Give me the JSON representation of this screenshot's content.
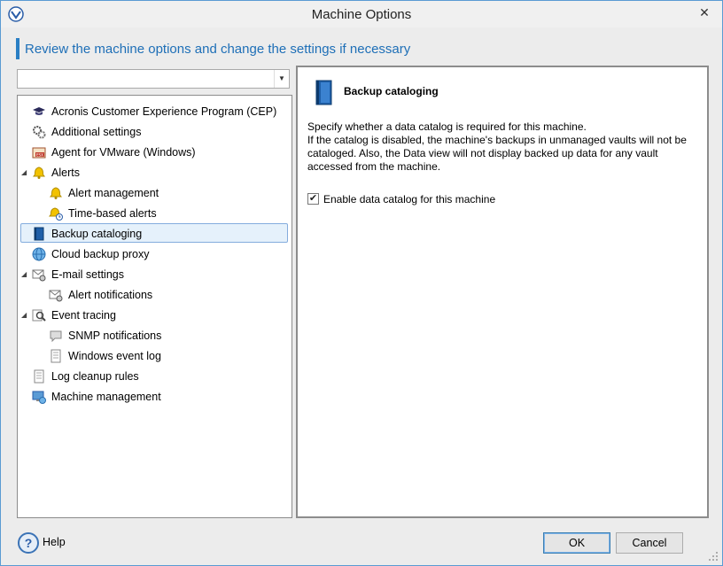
{
  "window": {
    "title": "Machine Options",
    "close_glyph": "✕"
  },
  "header": {
    "text": "Review the machine options and change the settings if necessary"
  },
  "dropdown": {
    "value": "",
    "arrow_glyph": "▼"
  },
  "tree": {
    "items": [
      {
        "label": "Acronis Customer Experience Program (CEP)",
        "icon": "graduation-cap-icon"
      },
      {
        "label": "Additional settings",
        "icon": "gears-icon"
      },
      {
        "label": "Agent for VMware (Windows)",
        "icon": "esx-agent-icon"
      },
      {
        "label": "Alerts",
        "icon": "bell-icon",
        "expanded": true
      },
      {
        "label": "Alert management",
        "icon": "bell-icon"
      },
      {
        "label": "Time-based alerts",
        "icon": "bell-clock-icon"
      },
      {
        "label": "Backup cataloging",
        "icon": "blue-book-icon",
        "selected": true
      },
      {
        "label": "Cloud backup proxy",
        "icon": "globe-icon"
      },
      {
        "label": "E-mail settings",
        "icon": "envelope-gear-icon",
        "expanded": true
      },
      {
        "label": "Alert notifications",
        "icon": "envelope-gear-icon"
      },
      {
        "label": "Event tracing",
        "icon": "magnifier-icon",
        "expanded": true
      },
      {
        "label": "SNMP notifications",
        "icon": "speech-bubble-icon"
      },
      {
        "label": "Windows event log",
        "icon": "log-document-icon"
      },
      {
        "label": "Log cleanup rules",
        "icon": "log-document-icon"
      },
      {
        "label": "Machine management",
        "icon": "monitor-globe-icon"
      }
    ],
    "expander_glyph": "◢"
  },
  "detail": {
    "title": "Backup cataloging",
    "description": [
      "Specify whether a data catalog is required for this machine.",
      "If the catalog is disabled, the machine's backups in unmanaged vaults will not be",
      "cataloged. Also, the Data view will not display backed up data for any vault",
      "accessed from the machine."
    ],
    "checkbox": {
      "label": "Enable data catalog for this machine",
      "checked": true,
      "glyph": "✔"
    }
  },
  "footer": {
    "help_glyph": "?",
    "help_label": "Help",
    "ok_label": "OK",
    "cancel_label": "Cancel"
  },
  "colors": {
    "accent": "#1e6fb7",
    "selection_bg": "#e5f1fb",
    "selection_border": "#84acdd"
  }
}
